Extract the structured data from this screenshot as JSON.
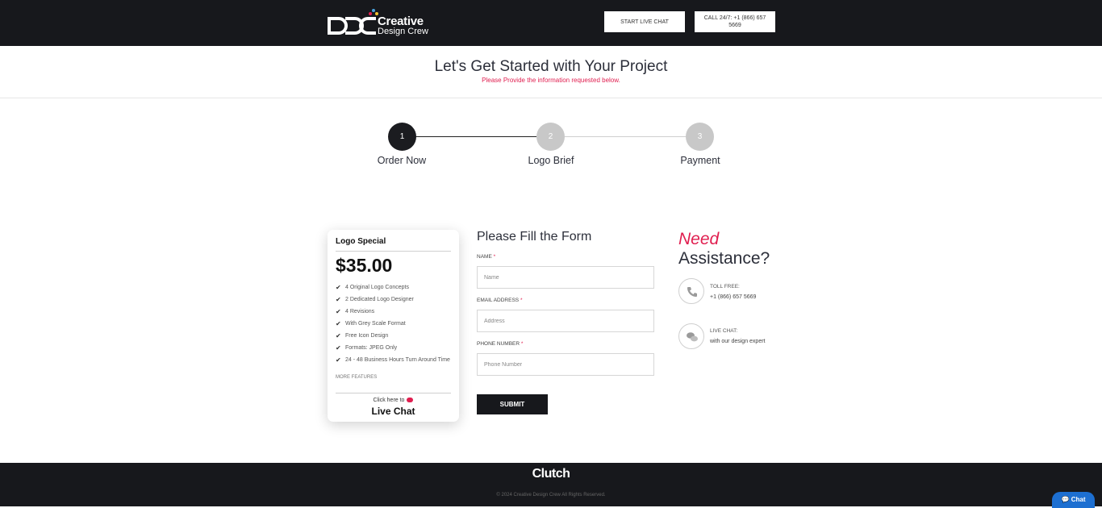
{
  "header": {
    "logo_line1": "Creative",
    "logo_line2": "Design Crew",
    "live_chat_button": "START LIVE CHAT",
    "call_button": "CALL 24/7: +1 (866) 657 5669"
  },
  "hero": {
    "title": "Let's Get Started with Your Project",
    "subtitle": "Please Provide the information requested below."
  },
  "steps": [
    {
      "number": "1",
      "label": "Order Now",
      "active": true
    },
    {
      "number": "2",
      "label": "Logo Brief",
      "active": false
    },
    {
      "number": "3",
      "label": "Payment",
      "active": false
    }
  ],
  "package": {
    "title": "Logo Special",
    "price": "$35.00",
    "features": [
      "4 Original Logo Concepts",
      "2 Dedicated Logo Designer",
      "4 Revisions",
      "With Grey Scale Format",
      "Free Icon Design",
      "Formats: JPEG Only",
      "24 - 48 Business Hours Turn Around Time"
    ],
    "more_features": "MORE FEATURES",
    "click_here": "Click here to",
    "live_chat": "Live Chat"
  },
  "form": {
    "title": "Please Fill the Form",
    "name_label": "NAME",
    "name_placeholder": "Name",
    "email_label": "EMAIL ADDRESS",
    "email_placeholder": "Address",
    "phone_label": "PHONE NUMBER",
    "phone_placeholder": "Phone Number",
    "required_mark": "*",
    "submit": "SUBMIT"
  },
  "assistance": {
    "need": "Need",
    "title": "Assistance?",
    "toll_free_label": "TOLL FREE:",
    "toll_free_value": "+1 (866) 657 5669",
    "live_chat_label": "LIVE CHAT:",
    "live_chat_value": "with our design expert"
  },
  "footer": {
    "clutch": "Clutch",
    "copyright": "© 2024 Creative Design Crew All Rights Reserved."
  },
  "chat_widget": {
    "label": "Chat"
  },
  "colors": {
    "dark": "#17181c",
    "accent": "#e01e4f",
    "chat_blue": "#1d6fd1"
  }
}
